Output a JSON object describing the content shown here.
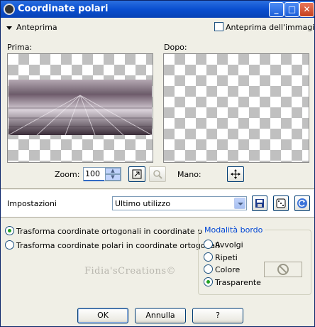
{
  "window": {
    "title": "Coordinate polari"
  },
  "titlebar": {
    "minimize": "_",
    "maximize": "□",
    "close": "✕"
  },
  "preview": {
    "toggle_label": "Anteprima",
    "image_preview_label": "Anteprima dell'immagine",
    "before_label": "Prima:",
    "after_label": "Dopo:",
    "zoom_label": "Zoom:",
    "zoom_value": "100",
    "pan_label": "Mano:"
  },
  "settings": {
    "label": "Impostazioni",
    "preset_value": "Ultimo utilizzo"
  },
  "options": {
    "rect_to_polar": "Trasforma coordinate ortogonali in coordinate polari",
    "polar_to_rect": "Trasforma coordinate polari in coordinate ortogonali",
    "selected": "rect_to_polar"
  },
  "edge_mode": {
    "title": "Modalità bordo",
    "wrap": "Avvolgi",
    "repeat": "Ripeti",
    "color": "Colore",
    "transparent": "Trasparente",
    "selected": "transparent"
  },
  "watermark": "Fidia'sCreations©",
  "buttons": {
    "ok": "OK",
    "cancel": "Annulla",
    "help": "?"
  },
  "colors": {
    "titlebar": "#0a4fd0",
    "accent_group": "#0046d5",
    "radio_on": "#21a121"
  },
  "icons": {
    "title": "app-icon",
    "zoom_fit": "zoom-fit-icon",
    "zoom_disabled": "magnifier-icon",
    "pan": "move-icon",
    "save": "save-icon",
    "random": "dice-icon",
    "reset": "reset-icon",
    "color_none": "no-color-icon"
  }
}
